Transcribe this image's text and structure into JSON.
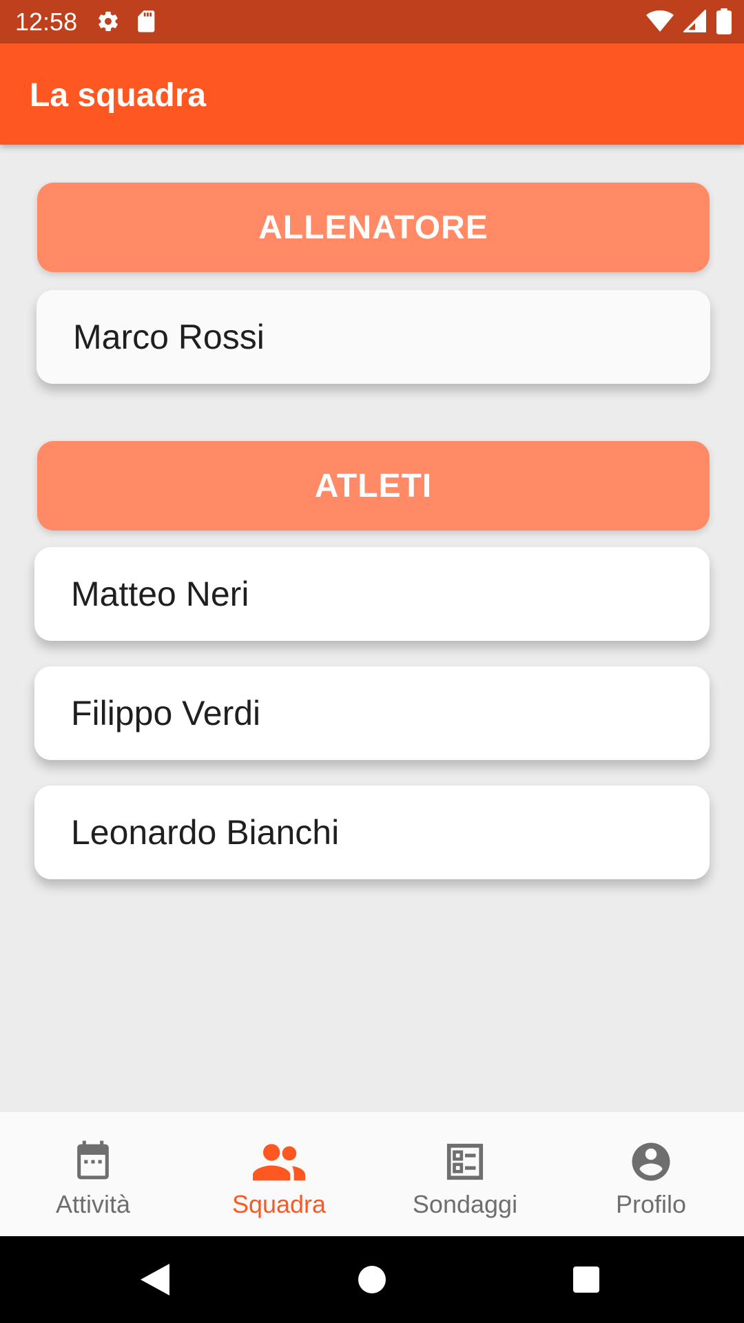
{
  "status_bar": {
    "time": "12:58",
    "left_icons": [
      "settings-icon",
      "sd-card-icon"
    ],
    "right_icons": [
      "wifi-icon",
      "signal-icon",
      "battery-icon"
    ]
  },
  "app_bar": {
    "title": "La squadra"
  },
  "sections": {
    "coach": {
      "header": "ALLENATORE",
      "members": [
        "Marco Rossi"
      ]
    },
    "athletes": {
      "header": "ATLETI",
      "members": [
        "Matteo Neri",
        "Filippo Verdi",
        "Leonardo Bianchi"
      ]
    }
  },
  "bottom_nav": {
    "items": [
      {
        "label": "Attività",
        "icon": "calendar-icon",
        "active": false
      },
      {
        "label": "Squadra",
        "icon": "group-icon",
        "active": true
      },
      {
        "label": "Sondaggi",
        "icon": "poll-icon",
        "active": false
      },
      {
        "label": "Profilo",
        "icon": "account-icon",
        "active": false
      }
    ]
  },
  "colors": {
    "status_bar": "#bf401c",
    "primary": "#ff5722",
    "section_header": "#ff8a65",
    "background": "#ececec",
    "inactive_nav": "#6e6e6e"
  }
}
